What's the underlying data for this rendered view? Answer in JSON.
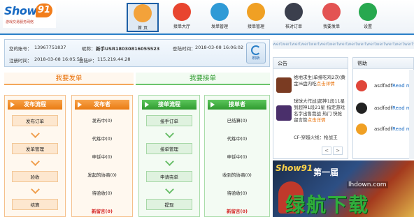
{
  "logo": {
    "word": "Show",
    "number": "91",
    "tagline": "游戏交易服务网络"
  },
  "nav": [
    {
      "label": "首 页",
      "active": true,
      "color": "#f3a23a"
    },
    {
      "label": "接单大厅",
      "active": false,
      "color": "#e8452f"
    },
    {
      "label": "发单管理",
      "active": false,
      "color": "#2f9ad6"
    },
    {
      "label": "接单管理",
      "active": false,
      "color": "#f0a024"
    },
    {
      "label": "核对订单",
      "active": false,
      "color": "#3b3f4d"
    },
    {
      "label": "我要发单",
      "active": false,
      "color": "#e35353"
    },
    {
      "label": "设置",
      "active": false,
      "color": "#27a84f"
    }
  ],
  "account": {
    "id_label": "您的账号：",
    "id_value": "13967751837",
    "nick_label": "昵称：",
    "nick_value": "新手USR18030816055523",
    "login_label": "登陆时间：",
    "login_value": "2018-03-08 16:06:02",
    "reg_label": "注册时间：",
    "reg_value": "2018-03-08 16:05:55",
    "ip_label": "登陆IP：",
    "ip_value": "115.219.44.28",
    "refresh_label": "刷新"
  },
  "headings": {
    "publish": "我要发单",
    "accept": "我要接单"
  },
  "publish_flow": {
    "title": "发布流程",
    "steps": [
      "发布订单",
      "发单管理",
      "验收",
      "结算"
    ]
  },
  "publisher": {
    "title": "发布者",
    "stats": [
      "发布中(0)",
      "代练中(0)",
      "申诉中(0)",
      "发起的协商(0)",
      "待验收(0)",
      "新留言(0)"
    ]
  },
  "accept_flow": {
    "title": "接单流程",
    "steps": [
      "接手订单",
      "接单管理",
      "申请完单",
      "提现"
    ]
  },
  "acceptor": {
    "title": "接单者",
    "stats": [
      "已结算(0)",
      "代练中(0)",
      "申诉中(0)",
      "收到的协商(0)",
      "待验收(0)",
      "新留言(0)"
    ]
  },
  "strip_text": "wertwertwertwertwertwertwertwertwertwertwertwertwertwertwertwertwertwert",
  "notice": {
    "title": "公告",
    "items": [
      {
        "text": "绝地求生|单排吃鸡2次(黄金)6盘内吃",
        "more": "点击详情",
        "color": "#7a3b22"
      },
      {
        "text": "球球大作战|超神1段11星到超神1段21星 指定游戏名字出售我战 热门 快抢 留言赞",
        "more": "点击详情",
        "color": "#4a2f6b"
      },
      {
        "text": "CF-穿越火线：枪战王",
        "more": "",
        "color": "#555"
      }
    ],
    "prev": "<",
    "next": ">"
  },
  "help": {
    "title": "帮助",
    "items": [
      {
        "text": "asdfadf",
        "more": "Read more",
        "color": "#e0463a"
      },
      {
        "text": "asdfadf",
        "more": "Read more",
        "color": "#222222"
      },
      {
        "text": "asdfadf",
        "more": "Read more",
        "color": "#f0a024"
      }
    ]
  },
  "banner": {
    "brand": "Show91",
    "title": "第一届",
    "site": "lhdown.com",
    "watermark": "绿航下载"
  }
}
